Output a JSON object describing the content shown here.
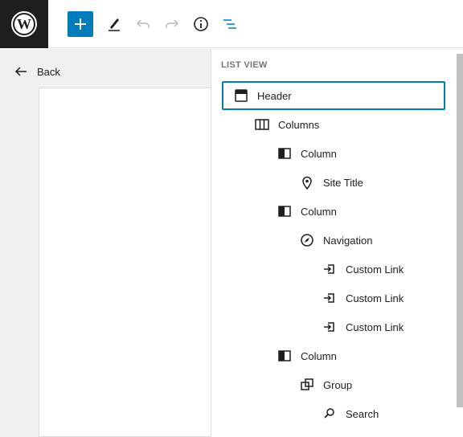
{
  "toolbar": {
    "logo_icon": "wordpress-logo-icon",
    "add_icon": "plus-icon",
    "edit_icon": "pencil-icon",
    "undo_icon": "undo-icon",
    "redo_icon": "redo-icon",
    "info_icon": "info-icon",
    "list_view_icon": "list-view-icon",
    "accent_color": "#007cba"
  },
  "editor": {
    "back_label": "Back"
  },
  "list_view": {
    "title": "LIST VIEW",
    "items": [
      {
        "label": "Header",
        "icon": "template-part-icon",
        "level": 1,
        "selected": true
      },
      {
        "label": "Columns",
        "icon": "columns-icon",
        "level": 2
      },
      {
        "label": "Column",
        "icon": "column-icon",
        "level": 3
      },
      {
        "label": "Site Title",
        "icon": "map-marker-icon",
        "level": 4
      },
      {
        "label": "Column",
        "icon": "column-icon",
        "level": 3
      },
      {
        "label": "Navigation",
        "icon": "compass-icon",
        "level": 4
      },
      {
        "label": "Custom Link",
        "icon": "custom-link-icon",
        "level": 5
      },
      {
        "label": "Custom Link",
        "icon": "custom-link-icon",
        "level": 5
      },
      {
        "label": "Custom Link",
        "icon": "custom-link-icon",
        "level": 5
      },
      {
        "label": "Column",
        "icon": "column-icon",
        "level": 3
      },
      {
        "label": "Group",
        "icon": "group-icon",
        "level": 4
      },
      {
        "label": "Search",
        "icon": "search-icon",
        "level": 5
      }
    ]
  }
}
